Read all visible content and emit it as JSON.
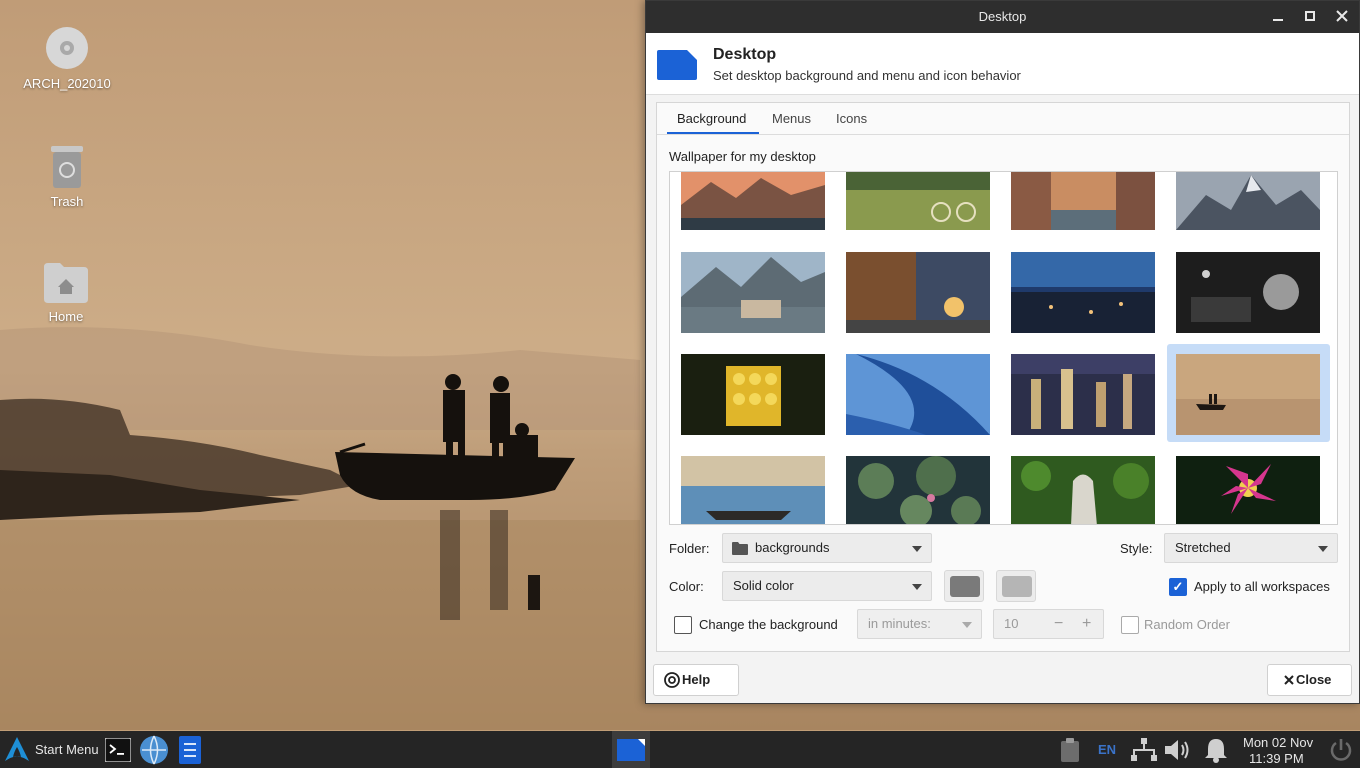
{
  "desktop": {
    "icons": [
      {
        "label": "ARCH_202010",
        "icon": "disc-icon"
      },
      {
        "label": "Trash",
        "icon": "trash-icon"
      },
      {
        "label": "Home",
        "icon": "home-folder-icon"
      }
    ]
  },
  "window": {
    "title": "Desktop",
    "controls": [
      "minimize",
      "maximize",
      "close"
    ],
    "header": {
      "title": "Desktop",
      "subtitle": "Set desktop background and menu and icon behavior"
    },
    "tabs": [
      {
        "label": "Background",
        "active": true
      },
      {
        "label": "Menus",
        "active": false
      },
      {
        "label": "Icons",
        "active": false
      }
    ],
    "wallpaper_label": "Wallpaper for my desktop",
    "wallpapers": [
      {
        "name": "mountain-sunset"
      },
      {
        "name": "bicycle-meadow"
      },
      {
        "name": "venice-canal"
      },
      {
        "name": "snowy-peaks"
      },
      {
        "name": "hallstatt-village"
      },
      {
        "name": "street-cafe"
      },
      {
        "name": "city-night-blue"
      },
      {
        "name": "piano-bw"
      },
      {
        "name": "emoji-cube"
      },
      {
        "name": "blue-architecture"
      },
      {
        "name": "city-lights-aerial"
      },
      {
        "name": "boat-fishermen",
        "selected": true
      },
      {
        "name": "boat-river"
      },
      {
        "name": "lily-pads"
      },
      {
        "name": "statue-leaves"
      },
      {
        "name": "pink-flower"
      }
    ],
    "folder": {
      "label": "Folder:",
      "value": "backgrounds"
    },
    "style": {
      "label": "Style:",
      "value": "Stretched"
    },
    "color": {
      "label": "Color:",
      "value": "Solid color",
      "primary": "#7a7a7a",
      "secondary": "#b5b5b5"
    },
    "apply_all": {
      "label": "Apply to all workspaces",
      "checked": true
    },
    "change_bg": {
      "label": "Change the background",
      "checked": false
    },
    "interval_unit": {
      "value": "in minutes:"
    },
    "interval": {
      "value": "10",
      "minus": "−",
      "plus": "+"
    },
    "random_order": {
      "label": "Random Order",
      "checked": false
    },
    "help_label": "Help",
    "close_label": "Close"
  },
  "taskbar": {
    "start_label": "Start Menu",
    "keyboard_layout": "EN",
    "date": "Mon 02 Nov",
    "time": "11:39 PM"
  },
  "colors": {
    "accent": "#1b62d6",
    "titlebar": "#2e2e2e",
    "taskbar": "#252525"
  }
}
